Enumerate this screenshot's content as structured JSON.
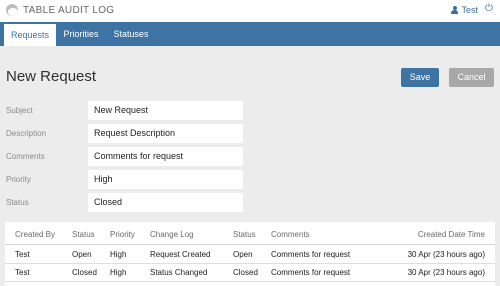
{
  "app": {
    "title": "TABLE AUDIT LOG"
  },
  "user": {
    "name": "Test"
  },
  "nav": {
    "tabs": [
      {
        "label": "Requests"
      },
      {
        "label": "Priorities"
      },
      {
        "label": "Statuses"
      }
    ]
  },
  "page": {
    "title": "New Request"
  },
  "actions": {
    "save": "Save",
    "cancel": "Cancel"
  },
  "form": {
    "subject": {
      "label": "Subject",
      "value": "New Request"
    },
    "description": {
      "label": "Description",
      "value": "Request Description"
    },
    "comments": {
      "label": "Comments",
      "value": "Comments for request"
    },
    "priority": {
      "label": "Priority",
      "value": "High"
    },
    "status": {
      "label": "Status",
      "value": "Closed"
    }
  },
  "table": {
    "headers": [
      "Created By",
      "Status",
      "Priority",
      "Change Log",
      "Status",
      "Comments",
      "Created Date Time"
    ],
    "rows": [
      [
        "Test",
        "Open",
        "High",
        "Request Created",
        "Open",
        "Comments for request",
        "30 Apr (23 hours ago)"
      ],
      [
        "Test",
        "Closed",
        "High",
        "Status Changed",
        "Closed",
        "Comments for request",
        "30 Apr (23 hours ago)"
      ]
    ]
  }
}
